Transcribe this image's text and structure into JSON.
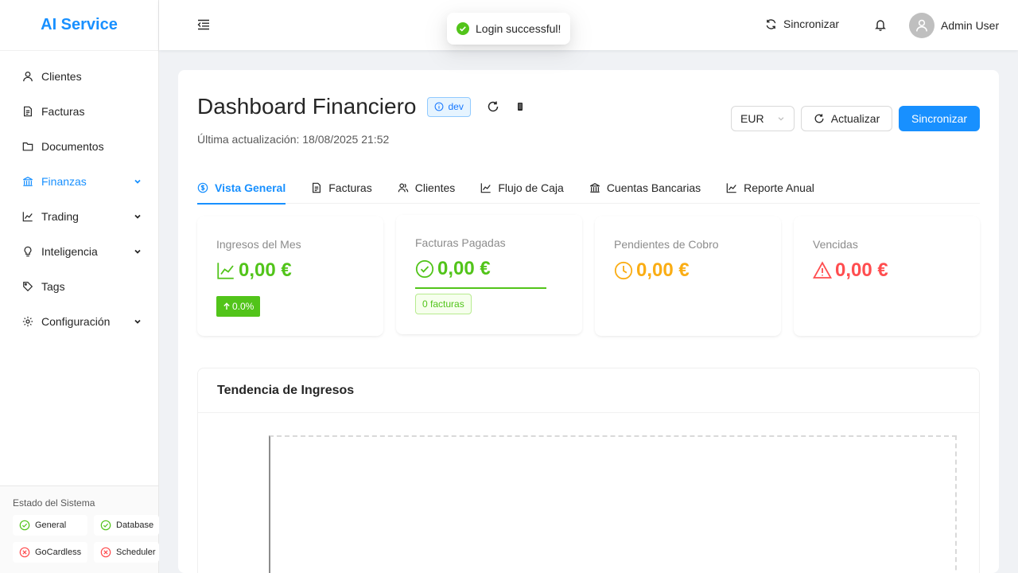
{
  "sidebar": {
    "logo": "AI Service",
    "items": [
      {
        "label": "Clientes"
      },
      {
        "label": "Facturas"
      },
      {
        "label": "Documentos"
      },
      {
        "label": "Finanzas"
      },
      {
        "label": "Trading"
      },
      {
        "label": "Inteligencia"
      },
      {
        "label": "Tags"
      },
      {
        "label": "Configuración"
      }
    ],
    "status": {
      "title": "Estado del Sistema",
      "items": [
        {
          "label": "General",
          "state": "ok"
        },
        {
          "label": "Database",
          "state": "ok"
        },
        {
          "label": "GoCardless",
          "state": "error"
        },
        {
          "label": "Scheduler",
          "state": "error"
        }
      ]
    }
  },
  "header": {
    "sync_label": "Sincronizar",
    "user_name": "Admin User"
  },
  "toast": {
    "message": "Login successful!"
  },
  "page": {
    "title": "Dashboard Financiero",
    "env_tag": "dev",
    "last_update": "Última actualización: 18/08/2025 21:52",
    "currency": "EUR",
    "refresh_label": "Actualizar",
    "sync_label": "Sincronizar"
  },
  "tabs": [
    {
      "label": "Vista General",
      "active": true
    },
    {
      "label": "Facturas"
    },
    {
      "label": "Clientes"
    },
    {
      "label": "Flujo de Caja"
    },
    {
      "label": "Cuentas Bancarias"
    },
    {
      "label": "Reporte Anual"
    }
  ],
  "stats": {
    "income": {
      "label": "Ingresos del Mes",
      "value": "0,00 €",
      "change": "0.0%"
    },
    "paid": {
      "label": "Facturas Pagadas",
      "value": "0,00 €",
      "count": "0 facturas"
    },
    "pending": {
      "label": "Pendientes de Cobro",
      "value": "0,00 €"
    },
    "overdue": {
      "label": "Vencidas",
      "value": "0,00 €"
    }
  },
  "chart": {
    "title": "Tendencia de Ingresos"
  },
  "colors": {
    "primary": "#1890ff",
    "success": "#52c41a",
    "warning": "#faad14",
    "danger": "#ff4d4f"
  }
}
